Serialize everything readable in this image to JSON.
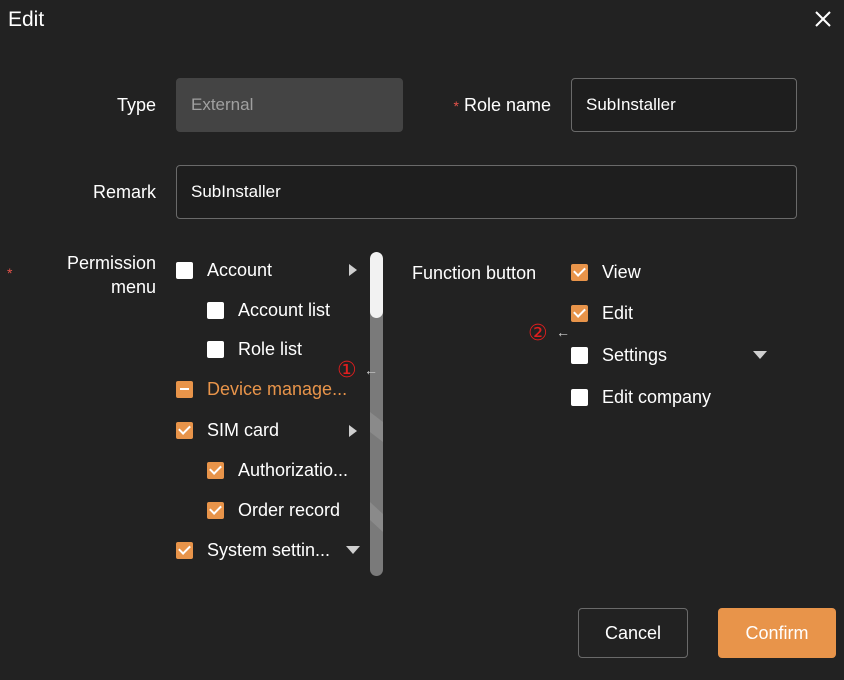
{
  "dialog": {
    "title": "Edit"
  },
  "form": {
    "type": {
      "label": "Type",
      "value": "External"
    },
    "role_name": {
      "required_mark": "*",
      "label": "Role name",
      "value": "SubInstaller"
    },
    "remark": {
      "label": "Remark",
      "value": "SubInstaller"
    },
    "permission": {
      "required_mark": "*",
      "label_line1": "Permission",
      "label_line2": "menu"
    }
  },
  "permission_tree": [
    {
      "label": "Account",
      "state": "unchecked"
    },
    {
      "label": "Account list",
      "state": "unchecked"
    },
    {
      "label": "Role list",
      "state": "unchecked"
    },
    {
      "label": "Device manage...",
      "state": "indeterminate"
    },
    {
      "label": "SIM card",
      "state": "checked"
    },
    {
      "label": "Authorizatio...",
      "state": "checked"
    },
    {
      "label": "Order record",
      "state": "checked"
    },
    {
      "label": "System settin...",
      "state": "checked"
    }
  ],
  "function_button": {
    "label": "Function button",
    "items": [
      {
        "label": "View",
        "state": "checked"
      },
      {
        "label": "Edit",
        "state": "checked"
      },
      {
        "label": "Settings",
        "state": "unchecked"
      },
      {
        "label": "Edit company",
        "state": "unchecked"
      }
    ]
  },
  "annotations": {
    "marker1": "①",
    "marker2": "②"
  },
  "buttons": {
    "cancel": "Cancel",
    "confirm": "Confirm"
  },
  "colors": {
    "accent": "#e8944a",
    "background": "#222222",
    "required": "#e5534b",
    "annotation": "#e01e1e"
  }
}
